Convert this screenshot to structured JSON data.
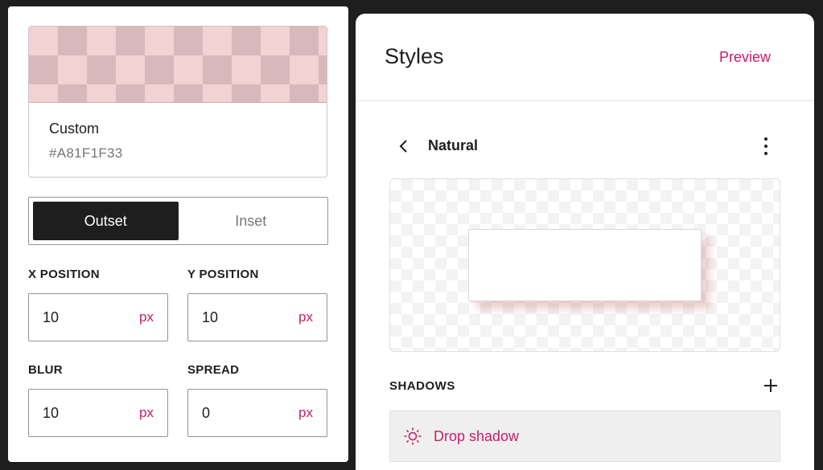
{
  "colors": {
    "accent": "#cc1a68",
    "shadow_color": "#A81F1F33"
  },
  "color_picker": {
    "name": "Custom",
    "hex": "#A81F1F33"
  },
  "shadow_type": {
    "options": [
      "Outset",
      "Inset"
    ],
    "selected": "Outset"
  },
  "fields": {
    "x_position": {
      "label": "X POSITION",
      "value": "10",
      "unit": "px"
    },
    "y_position": {
      "label": "Y POSITION",
      "value": "10",
      "unit": "px"
    },
    "blur": {
      "label": "BLUR",
      "value": "10",
      "unit": "px"
    },
    "spread": {
      "label": "SPREAD",
      "value": "0",
      "unit": "px"
    }
  },
  "styles_panel": {
    "title": "Styles",
    "preview_label": "Preview",
    "nav_title": "Natural",
    "shadows_label": "SHADOWS",
    "shadow_items": [
      {
        "label": "Drop shadow",
        "icon": "sun-icon"
      }
    ]
  }
}
